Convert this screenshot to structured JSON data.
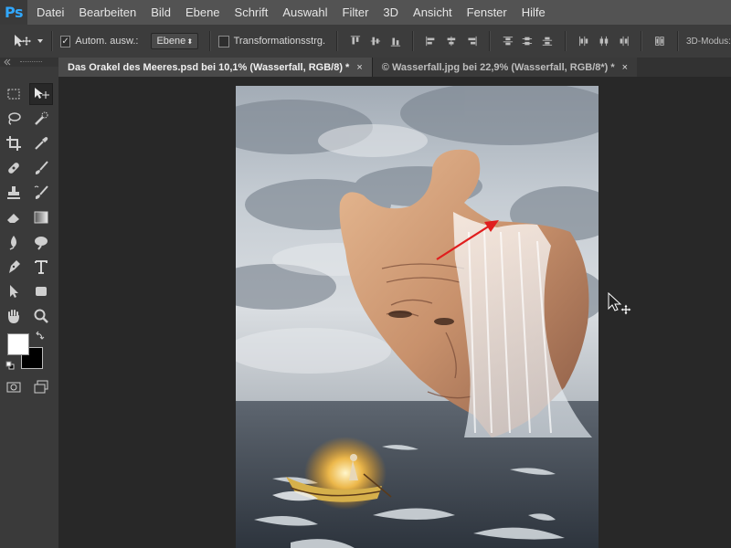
{
  "app": {
    "logo": "Ps"
  },
  "menu": [
    "Datei",
    "Bearbeiten",
    "Bild",
    "Ebene",
    "Schrift",
    "Auswahl",
    "Filter",
    "3D",
    "Ansicht",
    "Fenster",
    "Hilfe"
  ],
  "options": {
    "auto_select_label": "Autom. ausw.:",
    "auto_select_target": "Ebene",
    "transform_controls_label": "Transformationsstrg.",
    "mode_3d_label": "3D-Modus:"
  },
  "tabs": [
    {
      "title": "Das Orakel des Meeres.psd bei 10,1% (Wasserfall, RGB/8) *",
      "close": "×",
      "active": true
    },
    {
      "title": "© Wasserfall.jpg bei 22,9% (Wasserfall, RGB/8*) *",
      "close": "×",
      "active": false
    }
  ],
  "tools": [
    "marquee-tool-icon",
    "move-tool-icon",
    "lasso-tool-icon",
    "quick-selection-tool-icon",
    "crop-tool-icon",
    "eyedropper-tool-icon",
    "healing-brush-tool-icon",
    "brush-tool-icon",
    "clone-stamp-tool-icon",
    "history-brush-tool-icon",
    "eraser-tool-icon",
    "gradient-tool-icon",
    "blur-tool-icon",
    "dodge-tool-icon",
    "pen-tool-icon",
    "type-tool-icon",
    "path-selection-tool-icon",
    "rectangle-tool-icon",
    "hand-tool-icon",
    "zoom-tool-icon"
  ],
  "colors": {
    "foreground": "#ffffff",
    "background": "#000000",
    "accent": "#31a8ff",
    "arrow": "#e01e1e"
  }
}
